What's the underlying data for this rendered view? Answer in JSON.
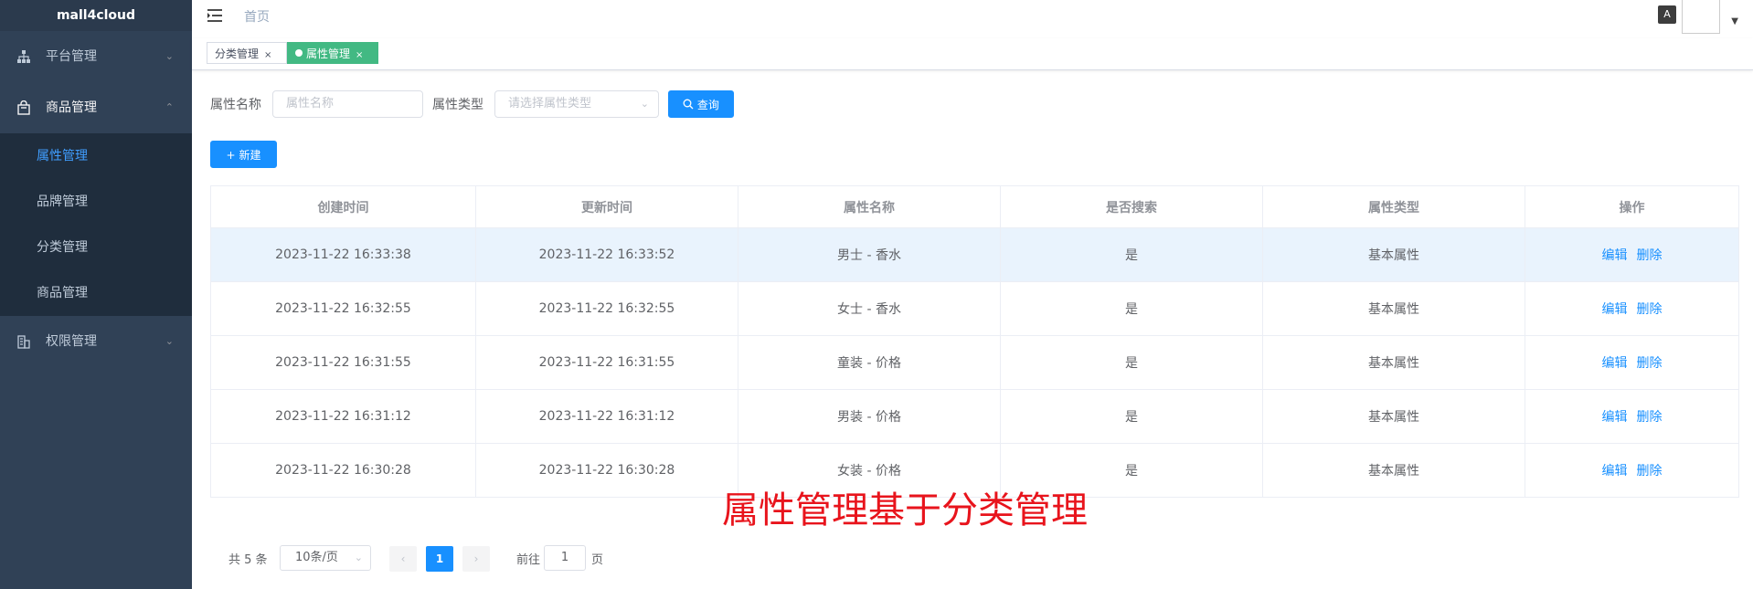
{
  "app": {
    "logo": "mall4cloud"
  },
  "sidebar": {
    "platform": "平台管理",
    "goods": "商品管理",
    "goods_sub": [
      "属性管理",
      "品牌管理",
      "分类管理",
      "商品管理"
    ],
    "permission": "权限管理",
    "icons": [
      "sitemap-icon",
      "shopping-bag-icon",
      "building-icon"
    ]
  },
  "navbar": {
    "breadcrumb": "首页",
    "lang_glyph": "A"
  },
  "tags": {
    "tab1": "分类管理",
    "tab2": "属性管理",
    "close": "×"
  },
  "filters": {
    "name_label": "属性名称",
    "name_placeholder": "属性名称",
    "type_label": "属性类型",
    "type_placeholder": "请选择属性类型",
    "search_button": "查询",
    "new_button": "新建"
  },
  "table": {
    "headers": [
      "创建时间",
      "更新时间",
      "属性名称",
      "是否搜索",
      "属性类型",
      "操作"
    ],
    "rows": [
      [
        "2023-11-22 16:33:38",
        "2023-11-22 16:33:52",
        "男士 - 香水",
        "是",
        "基本属性"
      ],
      [
        "2023-11-22 16:32:55",
        "2023-11-22 16:32:55",
        "女士 - 香水",
        "是",
        "基本属性"
      ],
      [
        "2023-11-22 16:31:55",
        "2023-11-22 16:31:55",
        "童装 - 价格",
        "是",
        "基本属性"
      ],
      [
        "2023-11-22 16:31:12",
        "2023-11-22 16:31:12",
        "男装 - 价格",
        "是",
        "基本属性"
      ],
      [
        "2023-11-22 16:30:28",
        "2023-11-22 16:30:28",
        "女装 - 价格",
        "是",
        "基本属性"
      ]
    ],
    "edit": "编辑",
    "delete": "删除"
  },
  "annotation": "属性管理基于分类管理",
  "pagination": {
    "total": "共 5 条",
    "page_size": "10条/页",
    "current_page": "1",
    "goto_label": "前往",
    "goto_value": "1",
    "page_suffix": "页"
  },
  "colors": {
    "sidebar_bg": "#304156",
    "accent": "#1890ff",
    "tag_active": "#42b983",
    "annotation": "#e8141c"
  }
}
